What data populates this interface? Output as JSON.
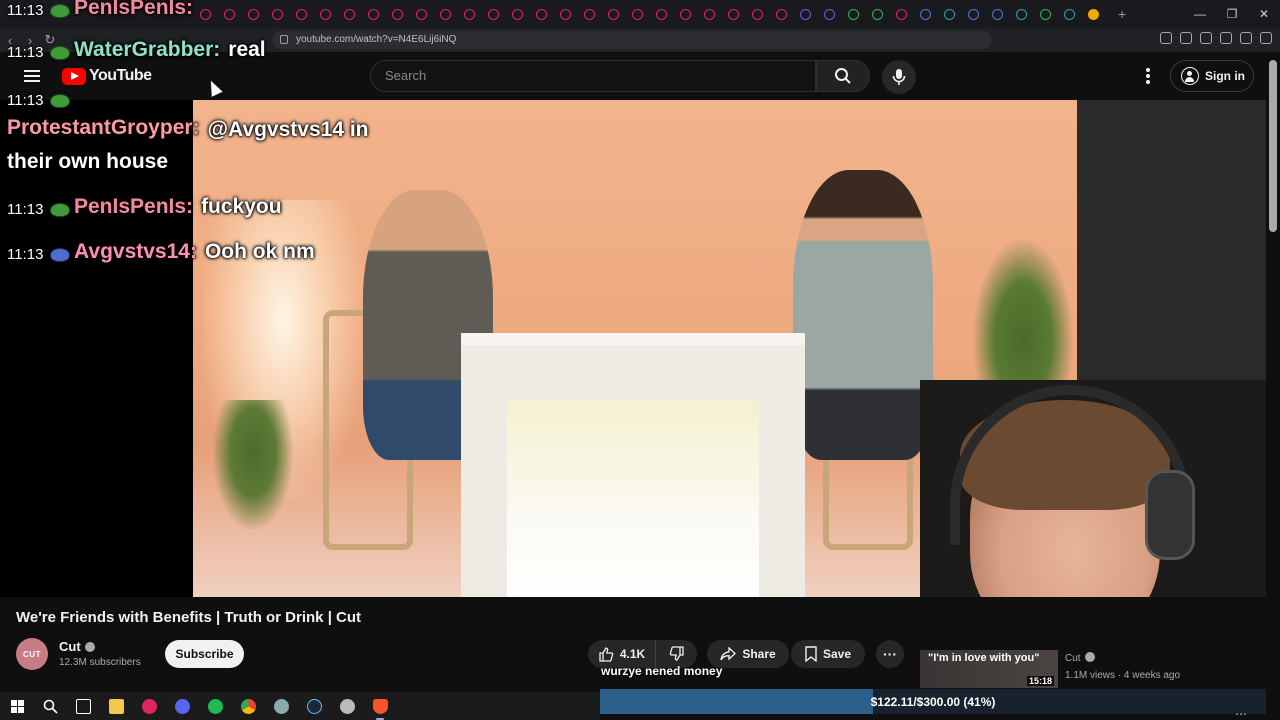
{
  "browser": {
    "url": "youtube.com/watch?v=N4E6Lij6iNQ",
    "tab_count_visible": 38
  },
  "youtube": {
    "logo_text": "YouTube",
    "search_placeholder": "Search",
    "sign_in_label": "Sign in"
  },
  "chat": {
    "messages": [
      {
        "time": "11:13",
        "user": "PenIsPenIs",
        "user_color": "#f28aa0",
        "text": ""
      },
      {
        "time": "11:13",
        "user": "WaterGrabber",
        "user_color": "#8fe3c4",
        "text": "real"
      },
      {
        "time": "11:13",
        "user": "",
        "user_color": "#ffffff",
        "text": ""
      },
      {
        "time": "",
        "user": "ProtestantGroyper",
        "user_color": "#ff99a8",
        "text": "@Avgvstvs14 in their own house"
      },
      {
        "time": "11:13",
        "user": "PenIsPenIs",
        "user_color": "#f28aa0",
        "text": "fuckyou"
      },
      {
        "time": "11:13",
        "user": "Avgvstvs14",
        "user_color": "#ff8fb0",
        "text": "Ooh ok nm"
      }
    ]
  },
  "video": {
    "title": "We're Friends with Benefits | Truth or Drink | Cut",
    "channel_name": "Cut",
    "channel_avatar_text": "CUT",
    "subscribers": "12.3M subscribers",
    "subscribe_label": "Subscribe",
    "likes": "4.1K",
    "share_label": "Share",
    "save_label": "Save",
    "more_label": "···",
    "caption": "wurzye nened money"
  },
  "recommendation": {
    "thumb_text": "\"I'm in love with you\"",
    "duration": "15:18",
    "channel": "Cut",
    "meta": "1.1M views · 4 weeks ago"
  },
  "goal": {
    "text": "$122.11/$300.00 (41%)",
    "fraction": 0.41
  },
  "colors": {
    "youtube_red": "#ff0000",
    "background": "#0f0f0f",
    "goal_fill": "#2c5f8a"
  },
  "icons": [
    "menu-icon",
    "youtube-logo-icon",
    "search-icon",
    "mic-icon",
    "more-vert-icon",
    "account-icon",
    "like-icon",
    "dislike-icon",
    "share-icon",
    "save-icon",
    "verified-icon"
  ]
}
